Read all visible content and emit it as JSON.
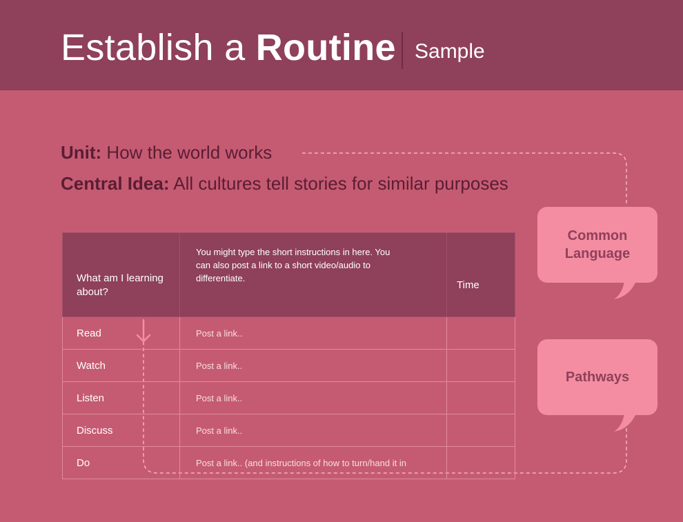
{
  "header": {
    "title_light": "Establish a ",
    "title_bold": "Routine",
    "subtitle": "Sample"
  },
  "unit": {
    "label": "Unit:",
    "value": " How the world works"
  },
  "central_idea": {
    "label": "Central Idea:",
    "value": " All cultures tell stories for similar purposes"
  },
  "table": {
    "headers": [
      "What am I learning about?",
      "You might type the short instructions in here. You can also post a link to a short video/audio to differentiate.",
      "Time"
    ],
    "rows": [
      {
        "activity": "Read",
        "link": "Post a link..",
        "time": ""
      },
      {
        "activity": "Watch",
        "link": "Post a link..",
        "time": ""
      },
      {
        "activity": "Listen",
        "link": "Post a link..",
        "time": ""
      },
      {
        "activity": "Discuss",
        "link": "Post a link..",
        "time": ""
      },
      {
        "activity": "Do",
        "link": "Post a link.. (and instructions of how to turn/hand it in",
        "time": ""
      }
    ]
  },
  "callouts": {
    "common_language": "Common Language",
    "pathways": "Pathways"
  },
  "colors": {
    "background": "#c55b72",
    "header": "#8f405b",
    "bubble": "#f48da1",
    "dark_text": "#5a1d34"
  }
}
